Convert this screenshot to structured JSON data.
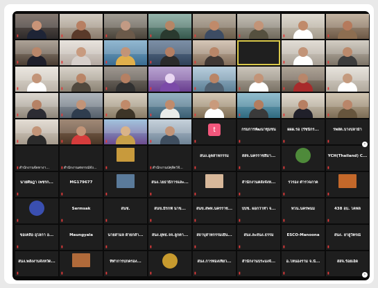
{
  "meeting": {
    "gallery": {
      "next_page_glyph": "›",
      "tiles": [
        {
          "kind": "video",
          "name": "",
          "c1": "#6a5b52",
          "c2": "#2d2a2a",
          "skin": "#c99478",
          "shirt": "#1e2436"
        },
        {
          "kind": "video",
          "name": "",
          "c1": "#c9c0b3",
          "c2": "#8b7c6d",
          "skin": "#b77f62",
          "shirt": "#5a3a2a"
        },
        {
          "kind": "video",
          "name": "",
          "c1": "#8f8a7f",
          "c2": "#4a433a",
          "skin": "#c29a84",
          "shirt": "#6b5a4a"
        },
        {
          "kind": "video",
          "name": "",
          "c1": "#7ea59a",
          "c2": "#36584d",
          "skin": "#b58666",
          "shirt": "#2a3a2f"
        },
        {
          "kind": "video",
          "name": "",
          "c1": "#a89c8c",
          "c2": "#6b5d4b",
          "skin": "#c08a6a",
          "shirt": "#3d4c63"
        },
        {
          "kind": "video",
          "name": "",
          "c1": "#b7b1a5",
          "c2": "#6f695c",
          "skin": "#c29478",
          "shirt": "#55503f"
        },
        {
          "kind": "video",
          "name": "",
          "c1": "#d8d2c6",
          "c2": "#a49b8c",
          "skin": "#c08a6a",
          "shirt": "#ffffff"
        },
        {
          "kind": "video",
          "name": "",
          "c1": "#b7a48e",
          "c2": "#6c5846",
          "skin": "#b57a5c",
          "shirt": "#8d6e51"
        },
        {
          "kind": "video",
          "name": "",
          "c1": "#9b8e80",
          "c2": "#4a3d33",
          "skin": "#b9866a",
          "shirt": "#1f1f2b"
        },
        {
          "kind": "video",
          "name": "",
          "c1": "#e3ddd6",
          "c2": "#b4aaa2",
          "skin": "#c89b7f",
          "shirt": "#d7d0cb"
        },
        {
          "kind": "video",
          "name": "",
          "c1": "#7aa8c7",
          "c2": "#3b6d92",
          "skin": "#c29478",
          "shirt": "#e0b04c"
        },
        {
          "kind": "video",
          "name": "",
          "c1": "#5f7793",
          "c2": "#2f4159",
          "skin": "#b37e63",
          "shirt": "#2b2b2b"
        },
        {
          "kind": "video",
          "name": "",
          "c1": "#cbb9a6",
          "c2": "#836e5b",
          "skin": "#b88668",
          "shirt": "#403834"
        },
        {
          "kind": "dark",
          "name": ""
        },
        {
          "kind": "video",
          "name": "",
          "c1": "#dcd6cc",
          "c2": "#a8a096",
          "skin": "#c29478",
          "shirt": "#ffffff"
        },
        {
          "kind": "video",
          "name": "",
          "c1": "#c9c2b6",
          "c2": "#7c7367",
          "skin": "#bb8a6c",
          "shirt": "#3d3d3d"
        },
        {
          "kind": "video",
          "name": "",
          "c1": "#e6e1d9",
          "c2": "#bbb3a8",
          "skin": "#c29478",
          "shirt": "#ffffff"
        },
        {
          "kind": "video",
          "name": "",
          "c1": "#d0c9bd",
          "c2": "#8c8375",
          "skin": "#b98567",
          "shirt": "#50483d"
        },
        {
          "kind": "video",
          "name": "",
          "c1": "#8a8177",
          "c2": "#45403a",
          "skin": "#b58063",
          "shirt": "#313131"
        },
        {
          "kind": "video",
          "name": "",
          "c1": "#a98fc7",
          "c2": "#6a3f8f",
          "skin": "#e9d7f2",
          "shirt": "#7b4aa8"
        },
        {
          "kind": "video",
          "name": "",
          "c1": "#a7c3d6",
          "c2": "#5d7f95",
          "skin": "#b98566",
          "shirt": "#506070"
        },
        {
          "kind": "video",
          "name": "",
          "c1": "#bfb8ab",
          "c2": "#7a7265",
          "skin": "#c29478",
          "shirt": "#ffffff"
        },
        {
          "kind": "video",
          "name": "",
          "c1": "#9c8f80",
          "c2": "#5b4f43",
          "skin": "#b8866a",
          "shirt": "#a82b2b"
        },
        {
          "kind": "video",
          "name": "",
          "c1": "#e2ddd5",
          "c2": "#b0a89c",
          "skin": "#c49a7e",
          "shirt": "#ffffff"
        },
        {
          "kind": "video",
          "name": "",
          "c1": "#d5cfc6",
          "c2": "#8f877b",
          "skin": "#b58266",
          "shirt": "#2c2c33"
        },
        {
          "kind": "video",
          "name": "",
          "c1": "#9ea6ae",
          "c2": "#56606b",
          "skin": "#c29478",
          "shirt": "#2f3d4e"
        },
        {
          "kind": "video",
          "name": "",
          "c1": "#cfc5b3",
          "c2": "#8a7d67",
          "skin": "#c08a6a",
          "shirt": "#3d3527"
        },
        {
          "kind": "video",
          "name": "",
          "c1": "#7fa2b6",
          "c2": "#3c5f73",
          "skin": "#bf8b6c",
          "shirt": "#e9ece9"
        },
        {
          "kind": "video",
          "name": "",
          "c1": "#cbbca5",
          "c2": "#7f6e55",
          "skin": "#c99a7c",
          "shirt": "#ffffff"
        },
        {
          "kind": "video",
          "name": "",
          "c1": "#7bb0c4",
          "c2": "#2f6a80",
          "skin": "#b37d5f",
          "shirt": "#3a3a3a"
        },
        {
          "kind": "video",
          "name": "",
          "c1": "#dad2c4",
          "c2": "#9a8f7c",
          "skin": "#b77f62",
          "shirt": "#20202a"
        },
        {
          "kind": "video",
          "name": "",
          "c1": "#c6b79f",
          "c2": "#7c6d56",
          "skin": "#b9866a",
          "shirt": "#66553d"
        },
        {
          "kind": "video",
          "name": "",
          "c1": "#ded6cb",
          "c2": "#a69b8d",
          "skin": "#c29478",
          "shirt": "#2b2b2b"
        },
        {
          "kind": "video",
          "name": "",
          "c1": "#8c6f58",
          "c2": "#4a3627",
          "skin": "#c29478",
          "shirt": "#d63c3c"
        },
        {
          "kind": "video",
          "name": "",
          "c1": "#8db6d6",
          "c2": "#6d4c8f",
          "skin": "#d9b38a",
          "shirt": "#c7a04a"
        },
        {
          "kind": "video",
          "name": "",
          "c1": "#b9c7d3",
          "c2": "#6f8396",
          "skin": "#c29478",
          "shirt": "#3f4e5f"
        },
        {
          "kind": "tumblr",
          "name": "",
          "glyph": "t"
        },
        {
          "kind": "text",
          "label": "กรมการพัฒนาชุมชน",
          "name": ""
        },
        {
          "kind": "text",
          "label": "ผผผ.รอ (รัชนีกร...",
          "name": ""
        },
        {
          "kind": "text",
          "label": "รพสต.บางปลาม้า",
          "name": ""
        },
        {
          "kind": "text",
          "label": "",
          "name": "สำนักงานจัดหางา..."
        },
        {
          "kind": "text",
          "label": "",
          "name": "สำนักงานสหกรณ์จัง..."
        },
        {
          "kind": "thumb",
          "c1": "#c89a3c",
          "name": ""
        },
        {
          "kind": "text",
          "label": "",
          "name": "สำนักงานปศุสัตว์จั..."
        },
        {
          "kind": "text",
          "label": "สนง.อุตสาหกรรม",
          "name": ""
        },
        {
          "kind": "text",
          "label": "สสจ.นครราชสีมา...",
          "name": ""
        },
        {
          "kind": "thumb-round",
          "c1": "#4e8a3a",
          "name": ""
        },
        {
          "kind": "text",
          "label": "YCH(Thailand) C...",
          "name": ""
        },
        {
          "kind": "text",
          "label": "นายศิษฎา เพชรก...",
          "name": ""
        },
        {
          "kind": "text",
          "label": "MG179677",
          "name": ""
        },
        {
          "kind": "thumb",
          "c1": "#5a7a9a",
          "name": ""
        },
        {
          "kind": "text",
          "label": "สนง.โยธาธิการและ...",
          "name": ""
        },
        {
          "kind": "thumb",
          "c1": "#d8b89a",
          "name": ""
        },
        {
          "kind": "text",
          "label": "สำนักงานคลังจังห...",
          "name": ""
        },
        {
          "kind": "text",
          "label": "รวรอง ตำรวจภาค",
          "name": ""
        },
        {
          "kind": "thumb",
          "c1": "#c4682a",
          "name": ""
        },
        {
          "kind": "thumb-round",
          "c1": "#3a4fb0",
          "name": ""
        },
        {
          "kind": "text",
          "label": "Sermsak",
          "name": ""
        },
        {
          "kind": "text",
          "label": "สนช.",
          "name": ""
        },
        {
          "kind": "text",
          "label": "สนข.มีรกฟ์ นาข...",
          "name": ""
        },
        {
          "kind": "text",
          "label": "สนข.สพท.นครราช...",
          "name": ""
        },
        {
          "kind": "text",
          "label": "ปปช. ผอกว่าทำ จ...",
          "name": ""
        },
        {
          "kind": "text",
          "label": "ทวน.นครพนม",
          "name": ""
        },
        {
          "kind": "text",
          "label": "438 อบ. โคฟล",
          "name": ""
        },
        {
          "kind": "text",
          "label": "ขอเคลือ อุไลกา อ...",
          "name": ""
        },
        {
          "kind": "text",
          "label": "Maungyala",
          "name": ""
        },
        {
          "kind": "text",
          "label": "นายสามล ผ้ายกลำ...",
          "name": ""
        },
        {
          "kind": "text",
          "label": "สนง.ยุทธ.จจ.ลูกตา...",
          "name": ""
        },
        {
          "kind": "text",
          "label": "สถาบุสาหกรรมเยีน...",
          "name": ""
        },
        {
          "kind": "text",
          "label": "สนง.ละสนง.ธรรม",
          "name": ""
        },
        {
          "kind": "text",
          "label": "ESCO-Manoona",
          "name": ""
        },
        {
          "kind": "text",
          "label": "สนง. ยาสูวัตรณ์",
          "name": ""
        },
        {
          "kind": "text",
          "label": "สนง.พลังงานจังหวัด...",
          "name": ""
        },
        {
          "kind": "thumb",
          "c1": "#b06a3a",
          "name": ""
        },
        {
          "kind": "text",
          "label": "ที่ทำการปกครอง...",
          "name": ""
        },
        {
          "kind": "thumb-round",
          "c1": "#c79a2e",
          "name": ""
        },
        {
          "kind": "text",
          "label": "สนง.การท่องเที่ยว...",
          "name": ""
        },
        {
          "kind": "text",
          "label": "สำนักงานประมงจั...",
          "name": ""
        },
        {
          "kind": "text",
          "label": "อ.โหนองราม จ.นั...",
          "name": ""
        },
        {
          "kind": "text",
          "label": "สสจ.ร้อยเอ็ด",
          "name": ""
        }
      ]
    }
  }
}
